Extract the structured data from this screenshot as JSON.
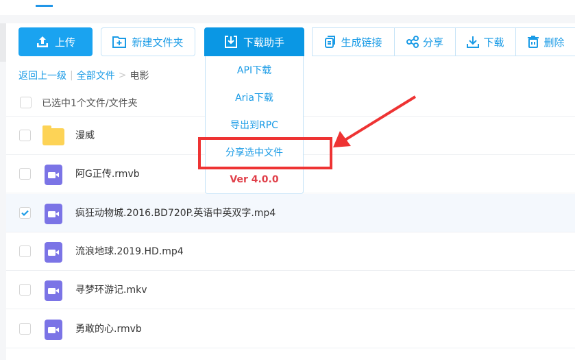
{
  "toolbar": {
    "upload": "上传",
    "new_folder": "新建文件夹",
    "download_helper": "下载助手",
    "gen_link": "生成链接",
    "share": "分享",
    "download": "下载",
    "delete": "删除"
  },
  "menu": {
    "items": [
      "API下载",
      "Aria下载",
      "导出到RPC",
      "分享选中文件"
    ],
    "version": "Ver 4.0.0"
  },
  "breadcrumb": {
    "back": "返回上一级",
    "sep": "|",
    "all": "全部文件",
    "arrow": ">",
    "current": "电影"
  },
  "selection": "已选中1个文件/文件夹",
  "files": [
    {
      "name": "漫威",
      "type": "folder",
      "checked": false
    },
    {
      "name": "阿G正传.rmvb",
      "type": "video",
      "checked": false
    },
    {
      "name": "疯狂动物城.2016.BD720P.英语中英双字.mp4",
      "type": "video",
      "checked": true
    },
    {
      "name": "流浪地球.2019.HD.mp4",
      "type": "video",
      "checked": false
    },
    {
      "name": "寻梦环游记.mkv",
      "type": "video",
      "checked": false
    },
    {
      "name": "勇敢的心.rmvb",
      "type": "video",
      "checked": false
    }
  ]
}
